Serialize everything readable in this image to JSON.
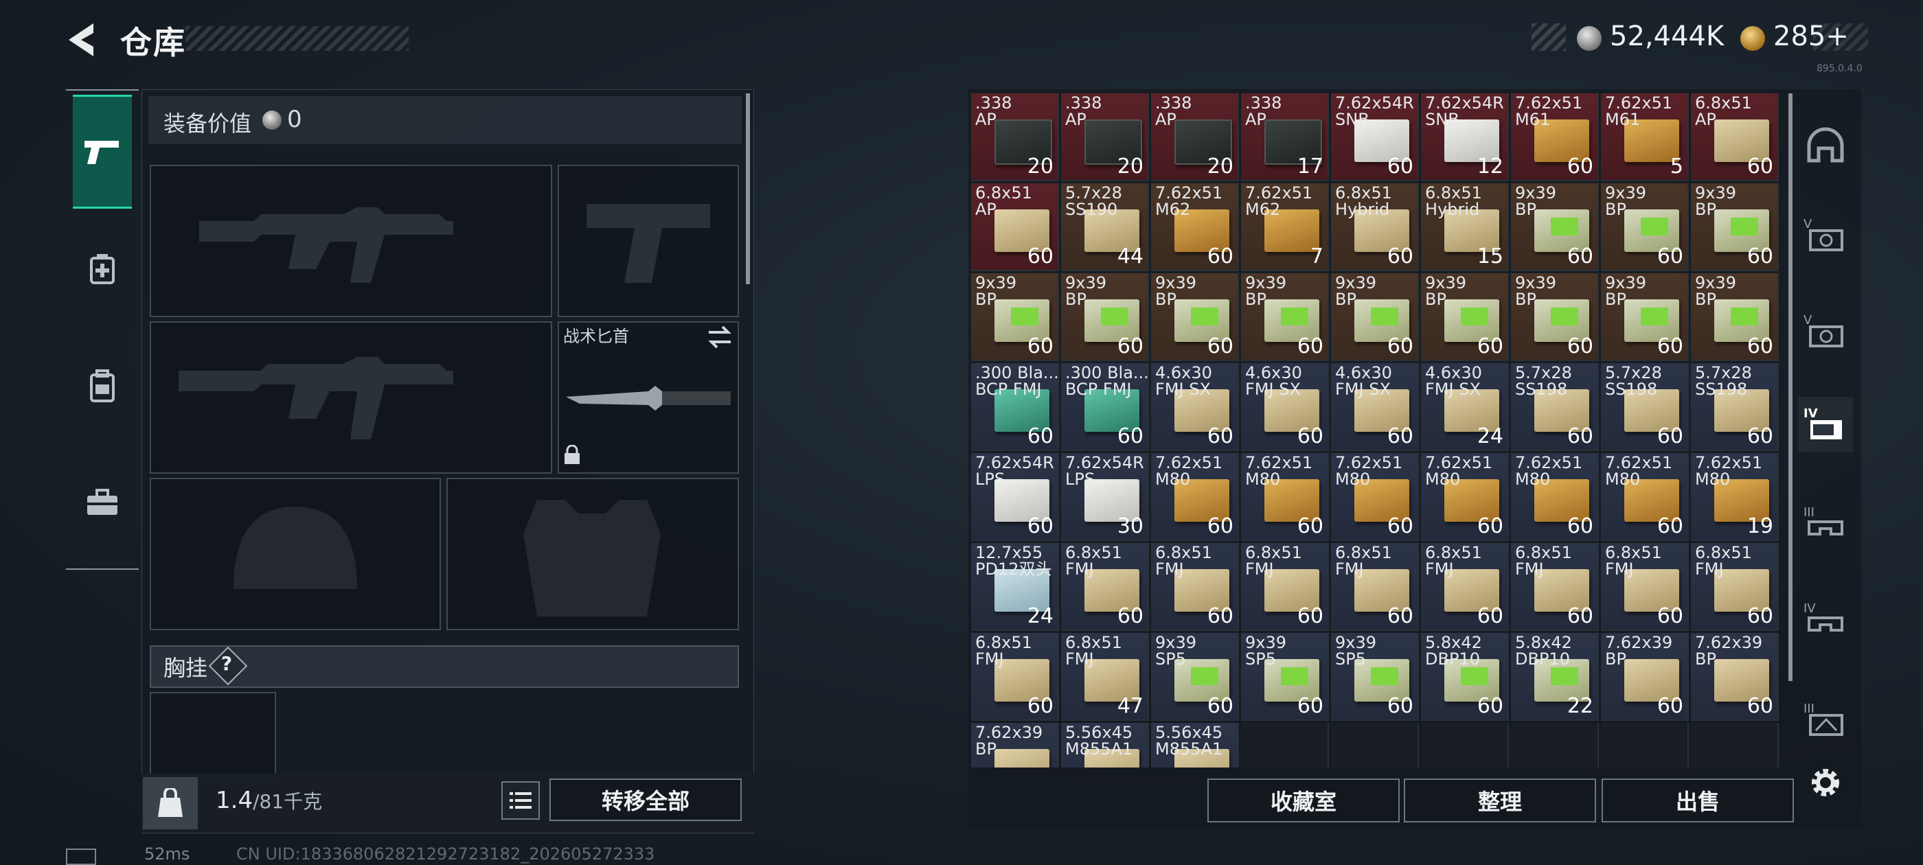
{
  "header": {
    "title": "仓库",
    "currency_1": "52,444K",
    "currency_2": "285+",
    "version": "895.0.4.0"
  },
  "equipment": {
    "value_label": "装备价值",
    "value": "0",
    "knife_name": "战术匕首",
    "rig_label": "胸挂",
    "rig_help": "?"
  },
  "bottom": {
    "weight": "1.4",
    "weight_max": "/81千克",
    "transfer_all": "转移全部"
  },
  "status": {
    "ping": "52ms",
    "uid": "CN UID:18336806282129272318​2_202605272333"
  },
  "actions": {
    "collection": "收藏室",
    "sort": "整理",
    "sell": "出售"
  },
  "rail_left": [
    "pistol-icon",
    "medkit-icon",
    "backpack-icon",
    "toolbox-icon"
  ],
  "rail_right": [
    "helmet-icon",
    "v-ammo-icon",
    "v-ammo-icon-2",
    "iv-ammo-icon",
    "iii-rig-icon",
    "iv-rig-icon",
    "iii-armor-icon",
    "gear-icon"
  ],
  "grid": [
    {
      "cal": ".338",
      "type": "AP",
      "qty": "20",
      "bg": "red",
      "box": "black"
    },
    {
      "cal": ".338",
      "type": "AP",
      "qty": "20",
      "bg": "red",
      "box": "black"
    },
    {
      "cal": ".338",
      "type": "AP",
      "qty": "20",
      "bg": "red",
      "box": "black"
    },
    {
      "cal": ".338",
      "type": "AP",
      "qty": "17",
      "bg": "red",
      "box": "black"
    },
    {
      "cal": "7.62x54R",
      "type": "SNB",
      "qty": "60",
      "bg": "red",
      "box": "white"
    },
    {
      "cal": "7.62x54R",
      "type": "SNB",
      "qty": "12",
      "bg": "red",
      "box": "white"
    },
    {
      "cal": "7.62x51",
      "type": "M61",
      "qty": "60",
      "bg": "red",
      "box": "orange"
    },
    {
      "cal": "7.62x51",
      "type": "M61",
      "qty": "5",
      "bg": "red",
      "box": "orange"
    },
    {
      "cal": "6.8x51",
      "type": "AP",
      "qty": "60",
      "bg": "red",
      "box": "tan"
    },
    {
      "cal": "6.8x51",
      "type": "AP",
      "qty": "60",
      "bg": "red",
      "box": "tan"
    },
    {
      "cal": "5.7x28",
      "type": "SS190",
      "qty": "44",
      "bg": "brown",
      "box": "tan"
    },
    {
      "cal": "7.62x51",
      "type": "M62",
      "qty": "60",
      "bg": "brown",
      "box": "orange"
    },
    {
      "cal": "7.62x51",
      "type": "M62",
      "qty": "7",
      "bg": "brown",
      "box": "orange"
    },
    {
      "cal": "6.8x51",
      "type": "Hybrid",
      "qty": "60",
      "bg": "brown",
      "box": "tan"
    },
    {
      "cal": "6.8x51",
      "type": "Hybrid",
      "qty": "15",
      "bg": "brown",
      "box": "tan"
    },
    {
      "cal": "9x39",
      "type": "BP",
      "qty": "60",
      "bg": "brown",
      "box": "green"
    },
    {
      "cal": "9x39",
      "type": "BP",
      "qty": "60",
      "bg": "brown",
      "box": "green"
    },
    {
      "cal": "9x39",
      "type": "BP",
      "qty": "60",
      "bg": "brown",
      "box": "green"
    },
    {
      "cal": "9x39",
      "type": "BP",
      "qty": "60",
      "bg": "brown",
      "box": "green"
    },
    {
      "cal": "9x39",
      "type": "BP",
      "qty": "60",
      "bg": "brown",
      "box": "green"
    },
    {
      "cal": "9x39",
      "type": "BP",
      "qty": "60",
      "bg": "brown",
      "box": "green"
    },
    {
      "cal": "9x39",
      "type": "BP",
      "qty": "60",
      "bg": "brown",
      "box": "green"
    },
    {
      "cal": "9x39",
      "type": "BP",
      "qty": "60",
      "bg": "brown",
      "box": "green"
    },
    {
      "cal": "9x39",
      "type": "BP",
      "qty": "60",
      "bg": "brown",
      "box": "green"
    },
    {
      "cal": "9x39",
      "type": "BP",
      "qty": "60",
      "bg": "brown",
      "box": "green"
    },
    {
      "cal": "9x39",
      "type": "BP",
      "qty": "60",
      "bg": "brown",
      "box": "green"
    },
    {
      "cal": "9x39",
      "type": "BP",
      "qty": "60",
      "bg": "brown",
      "box": "green"
    },
    {
      "cal": ".300 Bla...",
      "type": "BCP FMJ",
      "qty": "60",
      "bg": "navy",
      "box": "teal"
    },
    {
      "cal": ".300 Bla...",
      "type": "BCP FMJ",
      "qty": "60",
      "bg": "navy",
      "box": "teal"
    },
    {
      "cal": "4.6x30",
      "type": "FMJ SX",
      "qty": "60",
      "bg": "navy",
      "box": "tan"
    },
    {
      "cal": "4.6x30",
      "type": "FMJ SX",
      "qty": "60",
      "bg": "navy",
      "box": "tan"
    },
    {
      "cal": "4.6x30",
      "type": "FMJ SX",
      "qty": "60",
      "bg": "navy",
      "box": "tan"
    },
    {
      "cal": "4.6x30",
      "type": "FMJ SX",
      "qty": "24",
      "bg": "navy",
      "box": "tan"
    },
    {
      "cal": "5.7x28",
      "type": "SS198",
      "qty": "60",
      "bg": "navy",
      "box": "tan"
    },
    {
      "cal": "5.7x28",
      "type": "SS198",
      "qty": "60",
      "bg": "navy",
      "box": "tan"
    },
    {
      "cal": "5.7x28",
      "type": "SS198",
      "qty": "60",
      "bg": "navy",
      "box": "tan"
    },
    {
      "cal": "7.62x54R",
      "type": "LPS",
      "qty": "60",
      "bg": "navy",
      "box": "white"
    },
    {
      "cal": "7.62x54R",
      "type": "LPS",
      "qty": "30",
      "bg": "navy",
      "box": "white"
    },
    {
      "cal": "7.62x51",
      "type": "M80",
      "qty": "60",
      "bg": "navy",
      "box": "orange"
    },
    {
      "cal": "7.62x51",
      "type": "M80",
      "qty": "60",
      "bg": "navy",
      "box": "orange"
    },
    {
      "cal": "7.62x51",
      "type": "M80",
      "qty": "60",
      "bg": "navy",
      "box": "orange"
    },
    {
      "cal": "7.62x51",
      "type": "M80",
      "qty": "60",
      "bg": "navy",
      "box": "orange"
    },
    {
      "cal": "7.62x51",
      "type": "M80",
      "qty": "60",
      "bg": "navy",
      "box": "orange"
    },
    {
      "cal": "7.62x51",
      "type": "M80",
      "qty": "60",
      "bg": "navy",
      "box": "orange"
    },
    {
      "cal": "7.62x51",
      "type": "M80",
      "qty": "19",
      "bg": "navy",
      "box": "orange"
    },
    {
      "cal": "12.7x55",
      "type": "PD12双头",
      "qty": "24",
      "bg": "navy",
      "box": "ltblue"
    },
    {
      "cal": "6.8x51",
      "type": "FMJ",
      "qty": "60",
      "bg": "navy",
      "box": "tan"
    },
    {
      "cal": "6.8x51",
      "type": "FMJ",
      "qty": "60",
      "bg": "navy",
      "box": "tan"
    },
    {
      "cal": "6.8x51",
      "type": "FMJ",
      "qty": "60",
      "bg": "navy",
      "box": "tan"
    },
    {
      "cal": "6.8x51",
      "type": "FMJ",
      "qty": "60",
      "bg": "navy",
      "box": "tan"
    },
    {
      "cal": "6.8x51",
      "type": "FMJ",
      "qty": "60",
      "bg": "navy",
      "box": "tan"
    },
    {
      "cal": "6.8x51",
      "type": "FMJ",
      "qty": "60",
      "bg": "navy",
      "box": "tan"
    },
    {
      "cal": "6.8x51",
      "type": "FMJ",
      "qty": "60",
      "bg": "navy",
      "box": "tan"
    },
    {
      "cal": "6.8x51",
      "type": "FMJ",
      "qty": "60",
      "bg": "navy",
      "box": "tan"
    },
    {
      "cal": "6.8x51",
      "type": "FMJ",
      "qty": "60",
      "bg": "navy",
      "box": "tan"
    },
    {
      "cal": "6.8x51",
      "type": "FMJ",
      "qty": "47",
      "bg": "navy",
      "box": "tan"
    },
    {
      "cal": "9x39",
      "type": "SP5",
      "qty": "60",
      "bg": "navy",
      "box": "green"
    },
    {
      "cal": "9x39",
      "type": "SP5",
      "qty": "60",
      "bg": "navy",
      "box": "green"
    },
    {
      "cal": "9x39",
      "type": "SP5",
      "qty": "60",
      "bg": "navy",
      "box": "green"
    },
    {
      "cal": "5.8x42",
      "type": "DBP10",
      "qty": "60",
      "bg": "navy",
      "box": "green"
    },
    {
      "cal": "5.8x42",
      "type": "DBP10",
      "qty": "22",
      "bg": "navy",
      "box": "green"
    },
    {
      "cal": "7.62x39",
      "type": "BP",
      "qty": "60",
      "bg": "navy",
      "box": "tan"
    },
    {
      "cal": "7.62x39",
      "type": "BP",
      "qty": "60",
      "bg": "navy",
      "box": "tan"
    },
    {
      "cal": "7.62x39",
      "type": "BP",
      "qty": "",
      "bg": "navy",
      "box": "tan"
    },
    {
      "cal": "5.56x45",
      "type": "M855A1",
      "qty": "",
      "bg": "navy",
      "box": "tan"
    },
    {
      "cal": "5.56x45",
      "type": "M855A1",
      "qty": "",
      "bg": "navy",
      "box": "tan"
    },
    {
      "cal": "",
      "type": "",
      "qty": "",
      "bg": "empty",
      "box": ""
    },
    {
      "cal": "",
      "type": "",
      "qty": "",
      "bg": "empty",
      "box": ""
    },
    {
      "cal": "",
      "type": "",
      "qty": "",
      "bg": "empty",
      "box": ""
    },
    {
      "cal": "",
      "type": "",
      "qty": "",
      "bg": "empty",
      "box": ""
    },
    {
      "cal": "",
      "type": "",
      "qty": "",
      "bg": "empty",
      "box": ""
    },
    {
      "cal": "",
      "type": "",
      "qty": "",
      "bg": "empty",
      "box": ""
    }
  ]
}
